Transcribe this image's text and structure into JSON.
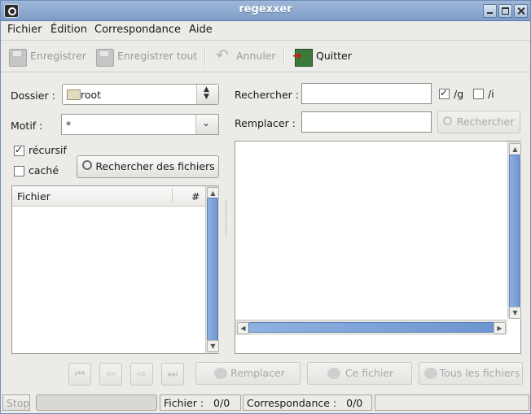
{
  "window": {
    "title": "regexxer"
  },
  "menubar": {
    "items": [
      "Fichier",
      "Édition",
      "Correspondance",
      "Aide"
    ]
  },
  "toolbar": {
    "save": "Enregistrer",
    "save_all": "Enregistrer tout",
    "undo": "Annuler",
    "quit": "Quitter"
  },
  "left": {
    "folder_label": "Dossier :",
    "folder_value": "root",
    "pattern_label": "Motif :",
    "pattern_value": "*",
    "recursive_label": "récursif",
    "recursive_checked": true,
    "hidden_label": "caché",
    "hidden_checked": false,
    "find_files_button": "Rechercher des fichiers",
    "file_list": {
      "columns": [
        "Fichier",
        "#"
      ],
      "rows": []
    }
  },
  "right": {
    "search_label": "Rechercher :",
    "search_value": "",
    "flag_g_label": "/g",
    "flag_g_checked": true,
    "flag_i_label": "/i",
    "flag_i_checked": false,
    "replace_label": "Remplacer :",
    "replace_value": "",
    "search_button": "Rechercher"
  },
  "actions": {
    "replace": "Remplacer",
    "this_file": "Ce fichier",
    "all_files": "Tous les fichiers"
  },
  "statusbar": {
    "stop": "Stop",
    "file_label": "Fichier :",
    "file_count": "0/0",
    "match_label": "Correspondance :",
    "match_count": "0/0"
  }
}
